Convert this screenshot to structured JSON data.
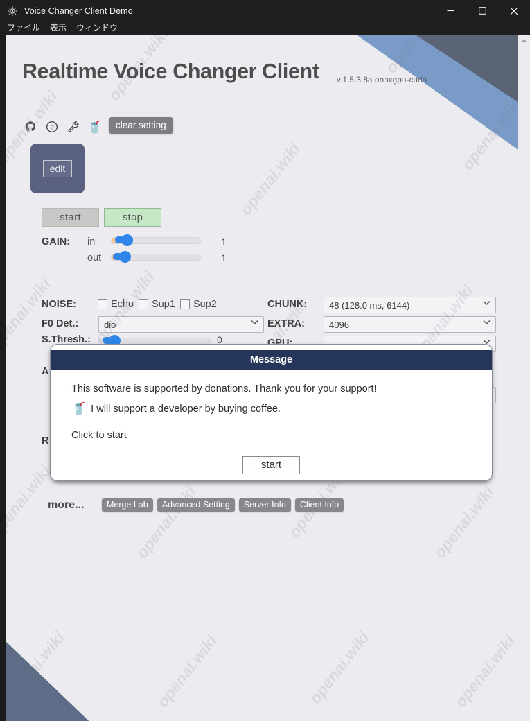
{
  "window": {
    "title": "Voice Changer Client Demo",
    "icon": "app-gear-icon",
    "minimize": "–",
    "maximize": "☐",
    "close": "✕"
  },
  "menubar": {
    "items": [
      {
        "label": "ファイル"
      },
      {
        "label": "表示"
      },
      {
        "label": "ウィンドウ"
      }
    ]
  },
  "header": {
    "app_title": "Realtime Voice Changer Client",
    "version": "v.1.5.3.8a  onnxgpu-cuda",
    "icons": [
      {
        "name": "github-icon"
      },
      {
        "name": "question-circle-icon"
      },
      {
        "name": "wrench-icon"
      },
      {
        "name": "coffee-cup-icon",
        "glyph": "🥤"
      }
    ],
    "clear_setting_label": "clear setting"
  },
  "character": {
    "edit_label": "edit"
  },
  "transport": {
    "start_label": "start",
    "stop_label": "stop"
  },
  "gain": {
    "label": "GAIN:",
    "rows": [
      {
        "name": "in",
        "value": "1"
      },
      {
        "name": "out",
        "value": "1"
      }
    ]
  },
  "noise": {
    "label": "NOISE:",
    "checkboxes": [
      {
        "label": "Echo",
        "checked": false
      },
      {
        "label": "Sup1",
        "checked": false
      },
      {
        "label": "Sup2",
        "checked": false
      }
    ]
  },
  "f0det": {
    "label": "F0 Det.:",
    "value": "dio"
  },
  "sthresh": {
    "label": "S.Thresh.:",
    "value": "0"
  },
  "chunk": {
    "label": "CHUNK:",
    "value": "48 (128.0 ms, 6144)"
  },
  "extra": {
    "label": "EXTRA:",
    "value": "4096"
  },
  "gpu": {
    "label": "GPU:",
    "value": ""
  },
  "hidden_rows": [
    {
      "label": "A"
    },
    {
      "label": "R"
    }
  ],
  "more": {
    "label": "more...",
    "buttons": [
      {
        "label": "Merge Lab"
      },
      {
        "label": "Advanced Setting"
      },
      {
        "label": "Server Info"
      },
      {
        "label": "Client Info"
      }
    ]
  },
  "dialog": {
    "title": "Message",
    "line1": "This software is supported by donations. Thank you for your support!",
    "coffee_glyph": "🥤",
    "line2": "I will support a developer by buying coffee.",
    "line3": "Click to start",
    "start_label": "start"
  },
  "watermark": {
    "text": "openai.wiki"
  },
  "colors": {
    "titlebar": "#1f1f1f",
    "page_bg": "#ecebef",
    "dialog_header": "#25365a",
    "accent_blue": "#2f86e8",
    "deco_blue": "#7a9bc8",
    "deco_slate": "#5e6c87",
    "stop_green": "#c7e8c7",
    "thumb_slate": "#5a6080"
  }
}
